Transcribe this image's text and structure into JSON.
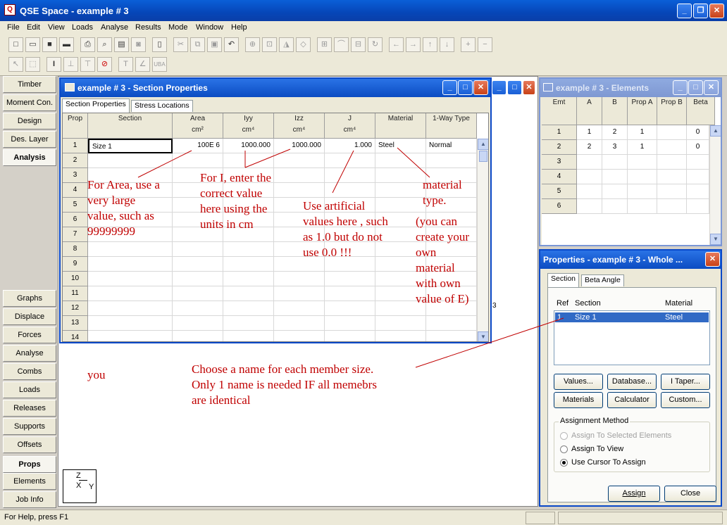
{
  "app": {
    "title": "QSE Space - example # 3"
  },
  "menu": [
    "File",
    "Edit",
    "View",
    "Loads",
    "Analyse",
    "Results",
    "Mode",
    "Window",
    "Help"
  ],
  "left_nav": {
    "top": [
      "Timber",
      "Moment Con.",
      "Design",
      "Des. Layer",
      "Analysis"
    ],
    "bottom": [
      "Graphs",
      "Displace",
      "Forces",
      "Analyse",
      "Combs",
      "Loads",
      "Releases",
      "Supports",
      "Offsets",
      "Props",
      "Elements",
      "Job Info"
    ],
    "active": [
      "Analysis",
      "Props"
    ]
  },
  "section_window": {
    "title": "example # 3 - Section Properties",
    "tabs": [
      "Section Properties",
      "Stress Locations"
    ],
    "headers": [
      {
        "label": "Prop",
        "unit": ""
      },
      {
        "label": "Section",
        "unit": ""
      },
      {
        "label": "Area",
        "unit": "cm²"
      },
      {
        "label": "Iyy",
        "unit": "cm⁴"
      },
      {
        "label": "Izz",
        "unit": "cm⁴"
      },
      {
        "label": "J",
        "unit": "cm⁴"
      },
      {
        "label": "Material",
        "unit": ""
      },
      {
        "label": "1-Way Type",
        "unit": ""
      }
    ],
    "row_numbers": [
      "1",
      "2",
      "3",
      "4",
      "5",
      "6",
      "7",
      "8",
      "9",
      "10",
      "11",
      "12",
      "13",
      "14"
    ],
    "row1": {
      "section": "Size 1",
      "area": "100E 6",
      "iyy": "1000.000",
      "izz": "1000.000",
      "j": "1.000",
      "material": "Steel",
      "type": "Normal"
    }
  },
  "elements_window": {
    "title": "example # 3 - Elements",
    "headers": [
      "Emt",
      "A",
      "B",
      "Prop A",
      "Prop B",
      "Beta"
    ],
    "rows": [
      {
        "n": "1",
        "a": "1",
        "b": "2",
        "propa": "1",
        "beta": "0"
      },
      {
        "n": "2",
        "a": "2",
        "b": "3",
        "propa": "1",
        "beta": "0"
      },
      {
        "n": "3"
      },
      {
        "n": "4"
      },
      {
        "n": "5"
      },
      {
        "n": "6"
      }
    ]
  },
  "props_window": {
    "title": "Properties - example # 3 - Whole ...",
    "tabs": [
      "Section",
      "Beta Angle"
    ],
    "list_headers": [
      "Ref",
      "Section",
      "Material"
    ],
    "list_row": {
      "ref": "1",
      "section": "Size 1",
      "material": "Steel"
    },
    "buttons": [
      "Values...",
      "Database...",
      "I Taper...",
      "Materials",
      "Calculator",
      "Custom..."
    ],
    "assignment_label": "Assignment Method",
    "radios": [
      "Assign To Selected Elements",
      "Assign To View",
      "Use Cursor To Assign"
    ],
    "assign": "Assign",
    "close": "Close"
  },
  "annotations": {
    "area": "For Area, use a\nvery large\nvalue, such as\n99999999",
    "inertia": "For I, enter the\ncorrect value\nhere using the\nunits in cm",
    "j": "Use artificial\nvalues here , such\nas 1.0 but do not\nuse 0.0 !!!",
    "material": "material\ntype.",
    "material_note": "(you can\ncreate your\nown\nmaterial\nwith own\nvalue of E)",
    "you": "you",
    "name": "Choose a name for each member size.\nOnly 1 name is needed  IF  all memebrs\nare identical"
  },
  "workarea": {
    "stray_text": "3",
    "axis": {
      "z": "Z",
      "x": "X",
      "y": "Y"
    }
  },
  "status": "For Help, press F1"
}
